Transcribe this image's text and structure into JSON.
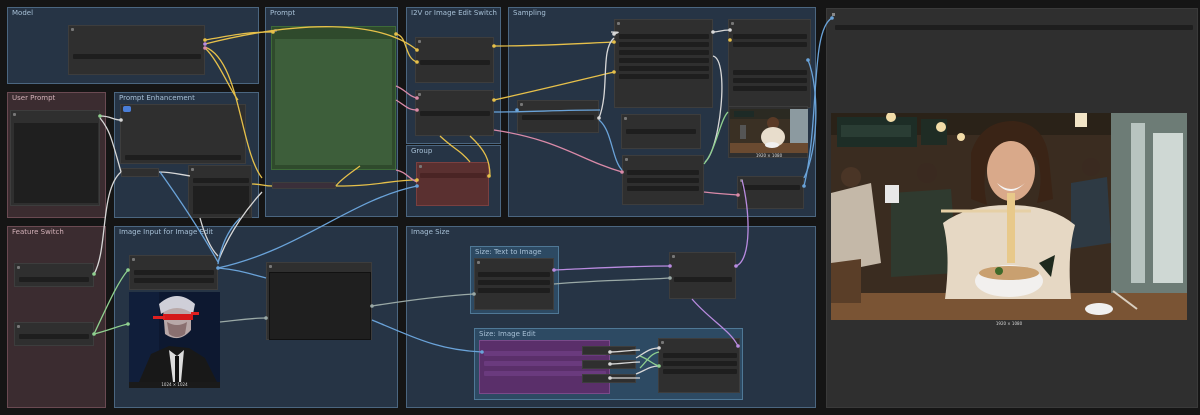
{
  "groups": {
    "model": "Model",
    "prompt": "Prompt",
    "i2v_switch": "I2V or Image Edit Switch",
    "sampling": "Sampling",
    "user_prompt": "User Prompt",
    "prompt_enhancement": "Prompt Enhancement",
    "group": "Group",
    "feature_switch": "Feature Switch",
    "image_input": "Image Input for Image Edit",
    "image_size": "Image Size",
    "size_text_to_image": "Size: Text to Image",
    "size_image_edit": "Size: Image Edit"
  },
  "images": {
    "input_caption": "1024 × 1024",
    "preview_caption": "1920 × 1080",
    "sample_caption": "1920 × 1080"
  },
  "colors": {
    "wire_yellow": "#e6c04a",
    "wire_blue": "#6aa3d9",
    "wire_pink": "#d98aa8",
    "wire_purple": "#b98be0",
    "wire_green": "#8fd08f",
    "wire_gray": "#9aa9a6",
    "wire_white": "#d8d8d8"
  }
}
